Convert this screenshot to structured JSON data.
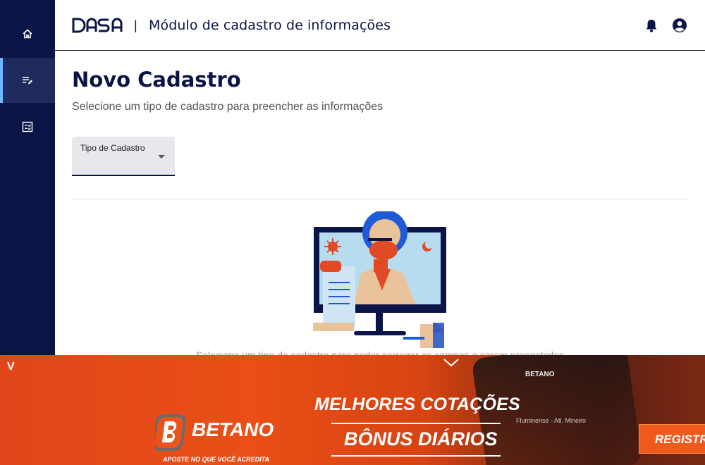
{
  "header": {
    "logo_alt": "DASA",
    "separator": "|",
    "title": "Módulo de cadastro de informações"
  },
  "sidebar": {
    "items": [
      {
        "name": "home",
        "icon": "home-icon",
        "active": false
      },
      {
        "name": "cadastro",
        "icon": "edit-list-icon",
        "active": true
      },
      {
        "name": "checklist",
        "icon": "checklist-icon",
        "active": false
      }
    ]
  },
  "main": {
    "title": "Novo Cadastro",
    "subtitle": "Selecione um tipo de cadastro para preencher as informações",
    "select": {
      "label": "Tipo de Cadastro",
      "value": ""
    },
    "empty_text": "Selecione um tipo de cadastro para poder carregar os campos a serem preenchidos"
  },
  "ad": {
    "badge": "V",
    "line1": "MELHORES COTAÇÕES",
    "line2": "BÔNUS DIÁRIOS",
    "brand": "BETANO",
    "tagline": "APOSTE NO QUE VOCÊ ACREDITA",
    "cta": "REGISTRE",
    "phone_brand": "BETANO",
    "phone_text": "Fluminense - Atl. Mineiro"
  },
  "colors": {
    "navy": "#0b1446",
    "sidebar_active": "#1f2a5e",
    "accent": "#6fb6ff",
    "ad_orange": "#ea4f17"
  }
}
